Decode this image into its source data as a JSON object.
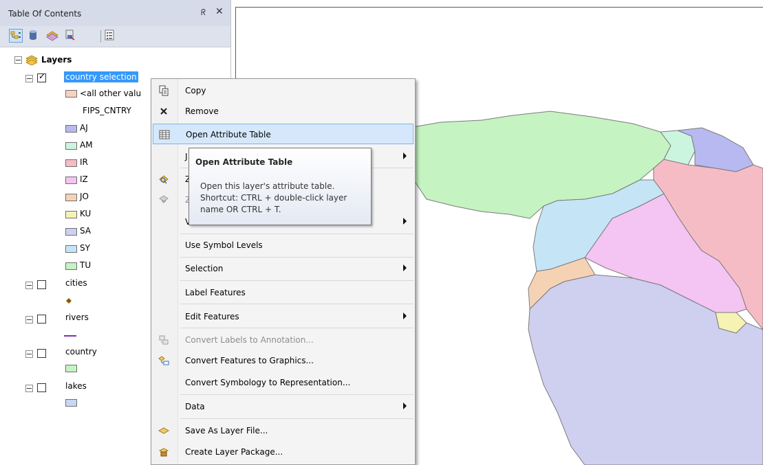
{
  "toc": {
    "title": "Table Of Contents",
    "pin_glyph": "ᖇ",
    "close_glyph": "✕",
    "toolbar_icons": [
      "list-by-drawing-order-icon",
      "list-by-source-icon",
      "list-by-visibility-icon",
      "list-by-selection-icon",
      "options-icon"
    ],
    "root": {
      "label": "Layers"
    },
    "layers": [
      {
        "label": "country selection",
        "checked": true,
        "selected": true,
        "legend": {
          "other_label": "<all other valu",
          "field": "FIPS_CNTRY",
          "classes": [
            {
              "label": "AJ",
              "color": "#b7b9f0"
            },
            {
              "label": "AM",
              "color": "#ccf5e0"
            },
            {
              "label": "IR",
              "color": "#f6bcc6"
            },
            {
              "label": "IZ",
              "color": "#f4c4f2"
            },
            {
              "label": "JO",
              "color": "#f6d2b5"
            },
            {
              "label": "KU",
              "color": "#f6f2b3"
            },
            {
              "label": "SA",
              "color": "#cfcff0"
            },
            {
              "label": "SY",
              "color": "#c5e5f6"
            },
            {
              "label": "TU",
              "color": "#c5f3c2"
            }
          ]
        }
      },
      {
        "label": "cities",
        "checked": false
      },
      {
        "label": "rivers",
        "checked": false
      },
      {
        "label": "country",
        "checked": false
      },
      {
        "label": "lakes",
        "checked": false
      }
    ]
  },
  "context_menu": {
    "items": [
      {
        "label": "Copy",
        "icon": "copy-icon"
      },
      {
        "label": "Remove",
        "icon": "remove-icon"
      },
      {
        "label": "Open Attribute Table",
        "icon": "table-icon",
        "hover": true
      },
      {
        "label": "J",
        "icon": "",
        "submenu": true
      },
      {
        "label": "Z",
        "icon": "zoom-to-layer-icon"
      },
      {
        "label": "Z",
        "icon": "zoom-scale-icon",
        "disabled": true
      },
      {
        "label": "V",
        "icon": "",
        "submenu": true
      },
      {
        "label": "Use Symbol Levels",
        "icon": ""
      },
      {
        "label": "Selection",
        "icon": "",
        "submenu": true
      },
      {
        "label": "Label Features",
        "icon": ""
      },
      {
        "label": "Edit Features",
        "icon": "",
        "submenu": true
      },
      {
        "label": "Convert Labels to Annotation...",
        "icon": "convert-labels-icon",
        "disabled": true
      },
      {
        "label": "Convert Features to Graphics...",
        "icon": "convert-graphics-icon"
      },
      {
        "label": "Convert Symbology to Representation...",
        "icon": ""
      },
      {
        "label": "Data",
        "icon": "",
        "submenu": true
      },
      {
        "label": "Save As Layer File...",
        "icon": "layer-file-icon"
      },
      {
        "label": "Create Layer Package...",
        "icon": "layer-package-icon"
      }
    ]
  },
  "tooltip": {
    "title": "Open Attribute Table",
    "body": "Open this layer's attribute table. Shortcut: CTRL + double-click layer name OR CTRL + T."
  },
  "map": {
    "country_colors": {
      "turkey": "#c5f3c2",
      "armenia": "#ccf5e0",
      "azerbaijan": "#b7b9f0",
      "iran": "#f6bcc6",
      "iraq": "#f4c4f2",
      "syria": "#c5e5f6",
      "jordan": "#f6d2b5",
      "kuwait": "#f6f2b3",
      "saudi_arabia": "#cfcff0"
    }
  }
}
